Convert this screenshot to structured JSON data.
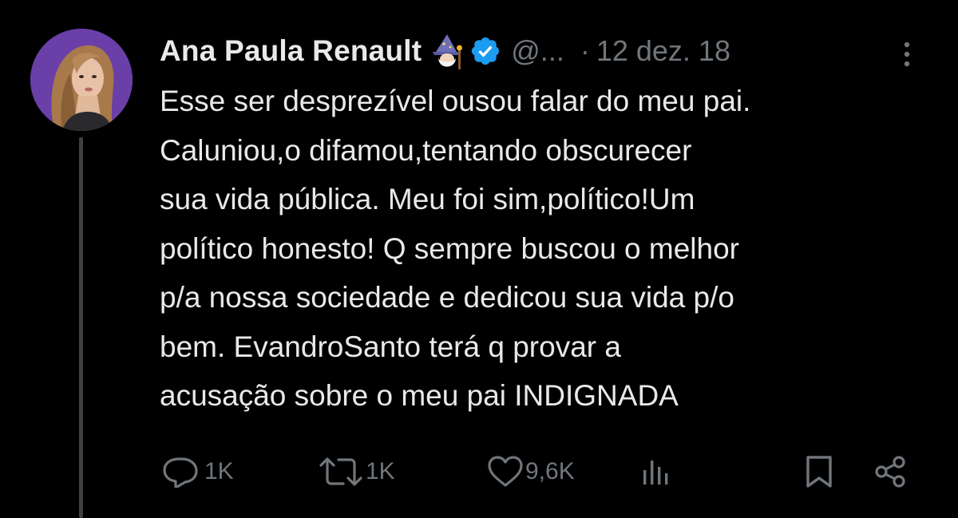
{
  "tweet": {
    "author_name": "Ana Paula Renault",
    "handle": "@...",
    "separator": "·",
    "date": "12 dez. 18",
    "body_lines": [
      "Esse ser desprezível ousou falar do meu pai.",
      "Caluniou,o difamou,tentando obscurecer",
      "sua vida pública. Meu foi sim,político!Um",
      "político honesto! Q sempre buscou o melhor",
      "p/a nossa sociedade e dedicou sua vida p/o",
      "bem. EvandroSanto terá q provar a",
      "acusação sobre o meu pai INDIGNADA"
    ],
    "actions": {
      "replies": "1K",
      "reposts": "1K",
      "likes": "9,6K"
    },
    "icons": {
      "badge_emoji": "wizard-emoji-icon",
      "verified": "verified-badge-icon",
      "more": "more-options-icon",
      "reply": "reply-icon",
      "repost": "repost-icon",
      "like": "heart-icon",
      "views": "views-chart-icon",
      "bookmark": "bookmark-icon",
      "share": "share-icon"
    },
    "colors": {
      "background": "#000000",
      "text_primary": "#e7e9ea",
      "text_secondary": "#71767b",
      "verified_blue": "#1d9bf0",
      "thread_line": "#3e4144"
    }
  }
}
